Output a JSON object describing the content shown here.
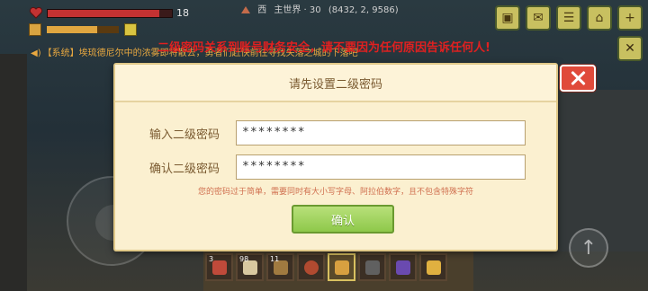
{
  "hud": {
    "health_value": "18",
    "health_fraction": 0.9,
    "food_fraction": 0.7,
    "world_direction": "西",
    "world_name": "主世界 · 30",
    "coordinates": "(8432, 2, 9586)"
  },
  "system_message": {
    "prefix": "【系统】",
    "text": "埃琉德尼尔中的浓雾即将散去，勇者们赶快前往寻找失落之城的下落吧"
  },
  "warning": "二级密码关系到账号财务安全，请不要因为任何原因告诉任何人!",
  "dialog": {
    "title": "请先设置二级密码",
    "password_label": "输入二级密码",
    "password_value": "********",
    "confirm_label": "确认二级密码",
    "confirm_value": "********",
    "hint": "您的密码过于简单，需要同时有大小写字母、阿拉伯数字，且不包含特殊字符",
    "confirm_button": "确认"
  },
  "hotbar": {
    "counts": [
      "3",
      "98",
      "11",
      "",
      "",
      "",
      "",
      ""
    ]
  },
  "icons": {
    "heart": "heart-icon",
    "close": "close-icon",
    "jump": "jump-arrow-icon"
  },
  "colors": {
    "warning_red": "#e02020",
    "dialog_bg": "#fbf0d0",
    "confirm_green": "#8ec84a",
    "close_red": "#e04a3a"
  }
}
